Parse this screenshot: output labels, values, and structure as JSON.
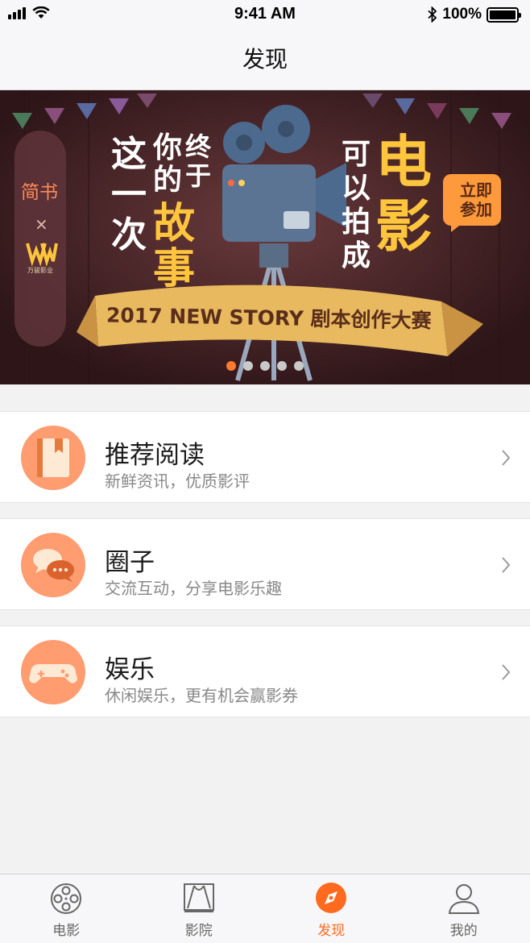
{
  "status_bar": {
    "time": "9:41 AM",
    "battery": "100%",
    "battery_level": 1.0
  },
  "header": {
    "title": "发现"
  },
  "banner": {
    "left_badge": {
      "brand_a": "简书",
      "times": "×",
      "brand_b": "万骏影业"
    },
    "headline_chars": [
      "这",
      "一",
      "次",
      "你",
      "的",
      "终",
      "于",
      "故",
      "事",
      "可",
      "以",
      "拍",
      "成",
      "电",
      "影"
    ],
    "cta": "立即参加",
    "ribbon": "2017 NEW STORY 剧本创作大赛",
    "pager": {
      "count": 5,
      "active_index": 0
    }
  },
  "list": [
    {
      "title": "推荐阅读",
      "subtitle": "新鲜资讯，优质影评",
      "icon": "book-icon"
    },
    {
      "title": "圈子",
      "subtitle": "交流互动，分享电影乐趣",
      "icon": "chat-bubbles-icon"
    },
    {
      "title": "娱乐",
      "subtitle": "休闲娱乐，更有机会赢影券",
      "icon": "gamepad-icon"
    }
  ],
  "tabbar": {
    "active": "发现",
    "tabs": [
      {
        "label": "电影",
        "icon": "film-reel-icon"
      },
      {
        "label": "影院",
        "icon": "cinema-icon"
      },
      {
        "label": "发现",
        "icon": "compass-icon"
      },
      {
        "label": "我的",
        "icon": "user-icon"
      }
    ]
  },
  "colors": {
    "accent": "#ff6a1f",
    "icon_bg": "#ff9c70",
    "banner_bg": "#3a1e21",
    "banner_yellow": "#ffc53d"
  }
}
